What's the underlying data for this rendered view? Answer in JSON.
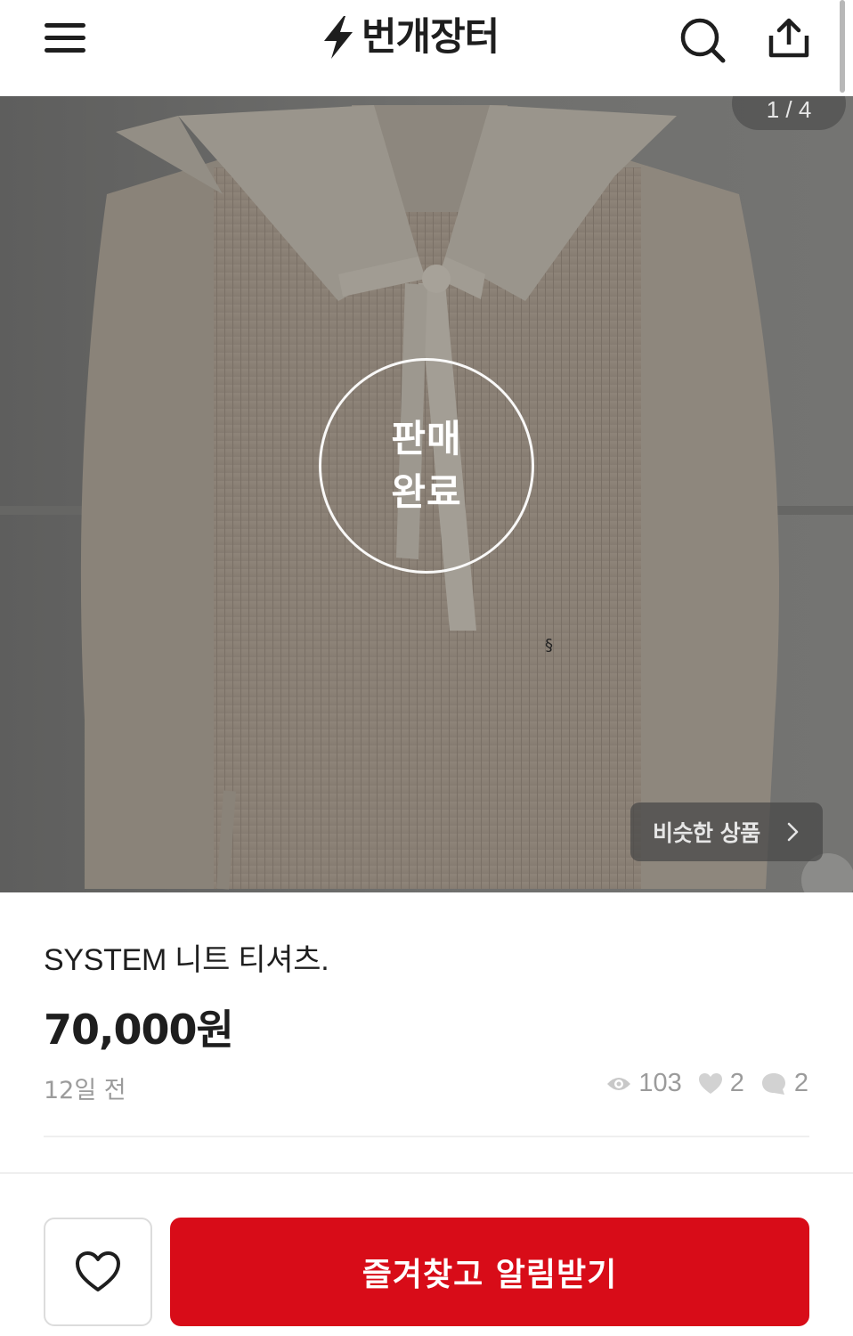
{
  "header": {
    "menu_icon": "hamburger-menu-icon",
    "logo_text": "번개장터",
    "logo_icon": "lightning-bolt-icon",
    "search_icon": "search-icon",
    "share_icon": "share-icon"
  },
  "gallery": {
    "counter": "1 / 4",
    "sold_label_line1": "판매",
    "sold_label_line2": "완료",
    "similar_button_label": "비슷한 상품",
    "similar_chevron_icon": "chevron-right-icon"
  },
  "product": {
    "title": "SYSTEM 니트 티셔츠.",
    "price": "70,000원",
    "time_ago": "12일 전",
    "views": "103",
    "likes": "2",
    "chats": "2"
  },
  "bottom_bar": {
    "like_icon": "heart-outline-icon",
    "cta_label": "즐겨찾고 알림받기"
  },
  "colors": {
    "brand_red": "#d80c18",
    "muted_text": "#9b9b9b",
    "primary_text": "#1e1e1e"
  }
}
